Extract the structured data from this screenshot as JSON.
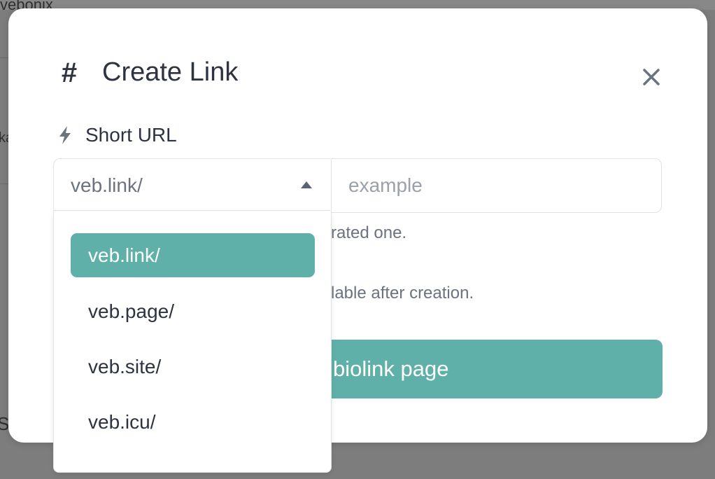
{
  "background": {
    "fragment_top": "vebonix",
    "fragment_left": "ka",
    "fragment_bottom": "S"
  },
  "modal": {
    "title": "Create Link",
    "header_icon": "hash-icon",
    "close_icon": "close-icon"
  },
  "short_url": {
    "label": "Short URL",
    "label_icon": "bolt-icon",
    "selected_domain": "veb.link/",
    "slug_placeholder": "example",
    "help_text_1": "rated one.",
    "help_text_2": "lable after creation."
  },
  "submit": {
    "label": "biolink page"
  },
  "dropdown": {
    "options": [
      {
        "label": "veb.link/",
        "selected": true
      },
      {
        "label": "veb.page/",
        "selected": false
      },
      {
        "label": "veb.site/",
        "selected": false
      },
      {
        "label": "veb.icu/",
        "selected": false
      }
    ]
  },
  "colors": {
    "accent": "#5fb0a9",
    "overlay": "#7d7d7d",
    "text_primary": "#2d3340",
    "text_muted": "#6b7280"
  }
}
